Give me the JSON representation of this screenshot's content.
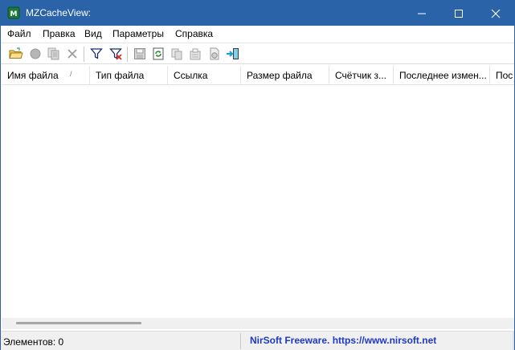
{
  "window": {
    "title": "MZCacheView:",
    "accent": "#2b63a8",
    "icon": "app-icon"
  },
  "menu": {
    "items": [
      "Файл",
      "Правка",
      "Вид",
      "Параметры",
      "Справка"
    ]
  },
  "toolbar": {
    "buttons": [
      "open-folder-icon",
      "stop-icon",
      "copy-records-icon",
      "delete-icon",
      "filter-icon",
      "filter-off-icon",
      "save-icon",
      "refresh-icon",
      "copy-icon",
      "properties-icon",
      "html-report-icon",
      "exit-icon"
    ]
  },
  "columns": [
    {
      "label": "Имя файла",
      "sort": "/"
    },
    {
      "label": "Тип файла"
    },
    {
      "label": "Ссылка"
    },
    {
      "label": "Размер файла"
    },
    {
      "label": "Счётчик з..."
    },
    {
      "label": "Последнее измен..."
    },
    {
      "label": "Пос"
    }
  ],
  "status": {
    "items_label": "Элементов: 0",
    "credit": "NirSoft Freeware. https://www.nirsoft.net",
    "credit_color": "#2038c8"
  }
}
